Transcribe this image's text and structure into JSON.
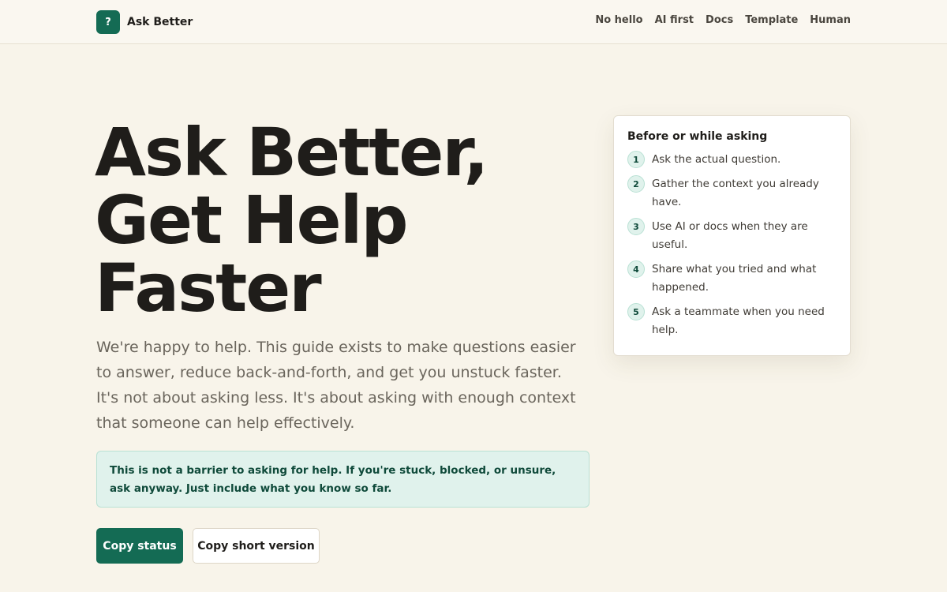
{
  "header": {
    "logo_glyph": "?",
    "brand": "Ask Better",
    "nav": [
      "No hello",
      "AI first",
      "Docs",
      "Template",
      "Human"
    ]
  },
  "hero": {
    "title_lines": [
      "Ask Better,",
      "Get Help",
      "Faster"
    ],
    "intro": "We're happy to help. This guide exists to make questions easier to answer, reduce back-and-forth, and get you unstuck faster. It's not about asking less. It's about asking with enough context that someone can help effectively.",
    "notice": "This is not a barrier to asking for help. If you're stuck, blocked, or unsure, ask anyway. Just include what you know so far.",
    "primary_button": "Copy status",
    "secondary_button": "Copy short version"
  },
  "card": {
    "title": "Before or while asking",
    "steps": [
      {
        "num": "1",
        "text": "Ask the actual question."
      },
      {
        "num": "2",
        "text": "Gather the context you already have."
      },
      {
        "num": "3",
        "text": "Use AI or docs when they are useful."
      },
      {
        "num": "4",
        "text": "Share what you tried and what happened."
      },
      {
        "num": "5",
        "text": "Ask a teammate when you need help."
      }
    ]
  },
  "colors": {
    "accent": "#146b54",
    "background": "#f8f4ea",
    "notice_bg": "#e0f2ec"
  }
}
